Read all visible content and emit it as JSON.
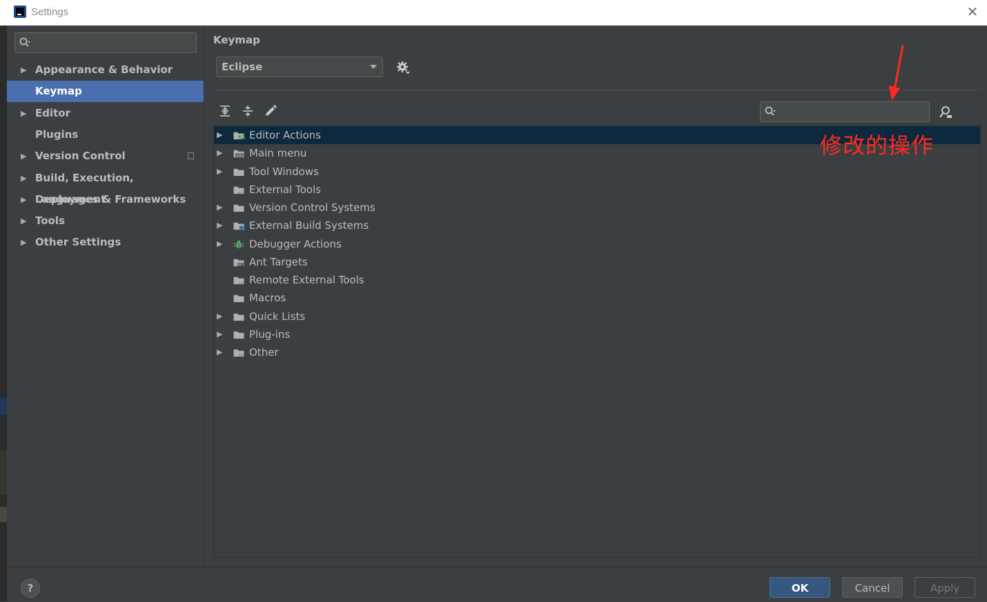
{
  "window": {
    "title": "Settings"
  },
  "sidebar": {
    "items": [
      {
        "label": "Appearance & Behavior",
        "expandable": true,
        "selected": false
      },
      {
        "label": "Keymap",
        "expandable": false,
        "selected": true
      },
      {
        "label": "Editor",
        "expandable": true,
        "selected": false
      },
      {
        "label": "Plugins",
        "expandable": false,
        "selected": false
      },
      {
        "label": "Version Control",
        "expandable": true,
        "selected": false
      },
      {
        "label": "Build, Execution, Deployment",
        "expandable": true,
        "selected": false
      },
      {
        "label": "Languages & Frameworks",
        "expandable": true,
        "selected": false
      },
      {
        "label": "Tools",
        "expandable": true,
        "selected": false
      },
      {
        "label": "Other Settings",
        "expandable": true,
        "selected": false
      }
    ]
  },
  "keymap": {
    "section_title": "Keymap",
    "selected_keymap": "Eclipse",
    "tree": [
      {
        "label": "Editor Actions",
        "expandable": true,
        "selected": true,
        "icon": "editor-actions-folder-icon"
      },
      {
        "label": "Main menu",
        "expandable": true,
        "selected": false,
        "icon": "menu-folder-icon"
      },
      {
        "label": "Tool Windows",
        "expandable": true,
        "selected": false,
        "icon": "folder-icon"
      },
      {
        "label": "External Tools",
        "expandable": false,
        "selected": false,
        "icon": "external-tools-folder-icon"
      },
      {
        "label": "Version Control Systems",
        "expandable": true,
        "selected": false,
        "icon": "folder-icon"
      },
      {
        "label": "External Build Systems",
        "expandable": true,
        "selected": false,
        "icon": "build-systems-folder-icon"
      },
      {
        "label": "Debugger Actions",
        "expandable": true,
        "selected": false,
        "icon": "bug-icon"
      },
      {
        "label": "Ant Targets",
        "expandable": false,
        "selected": false,
        "icon": "ant-folder-icon"
      },
      {
        "label": "Remote External Tools",
        "expandable": false,
        "selected": false,
        "icon": "remote-tools-folder-icon"
      },
      {
        "label": "Macros",
        "expandable": false,
        "selected": false,
        "icon": "folder-icon"
      },
      {
        "label": "Quick Lists",
        "expandable": true,
        "selected": false,
        "icon": "folder-icon"
      },
      {
        "label": "Plug-ins",
        "expandable": true,
        "selected": false,
        "icon": "folder-icon"
      },
      {
        "label": "Other",
        "expandable": true,
        "selected": false,
        "icon": "other-folder-icon"
      }
    ]
  },
  "annotation": {
    "text": "修改的操作",
    "color": "#ff2a1f"
  },
  "buttons": {
    "ok": "OK",
    "cancel": "Cancel",
    "apply": "Apply",
    "help": "?"
  },
  "colors": {
    "selection": "#4b6eaf",
    "tree_selection": "#0d293e",
    "background": "#3c3f41"
  }
}
